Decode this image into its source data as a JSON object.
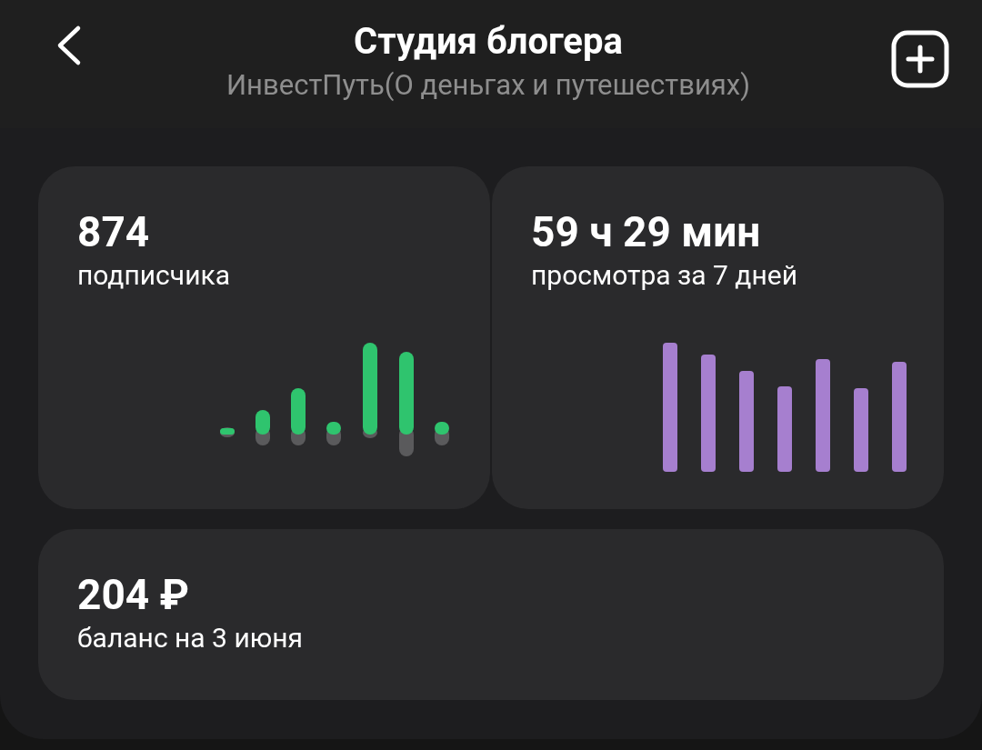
{
  "header": {
    "title": "Студия блогера",
    "subtitle": "ИнвестПуть(О деньгах и путешествиях)"
  },
  "cards": [
    {
      "kind": "green_chart",
      "value": "874",
      "label": "подписчика"
    },
    {
      "kind": "purple_chart",
      "value": "59 ч 29 мин",
      "label": "просмотра за 7 дней"
    },
    {
      "kind": "plain",
      "value": "204 ₽",
      "label": "баланс на 3 июня"
    }
  ]
}
